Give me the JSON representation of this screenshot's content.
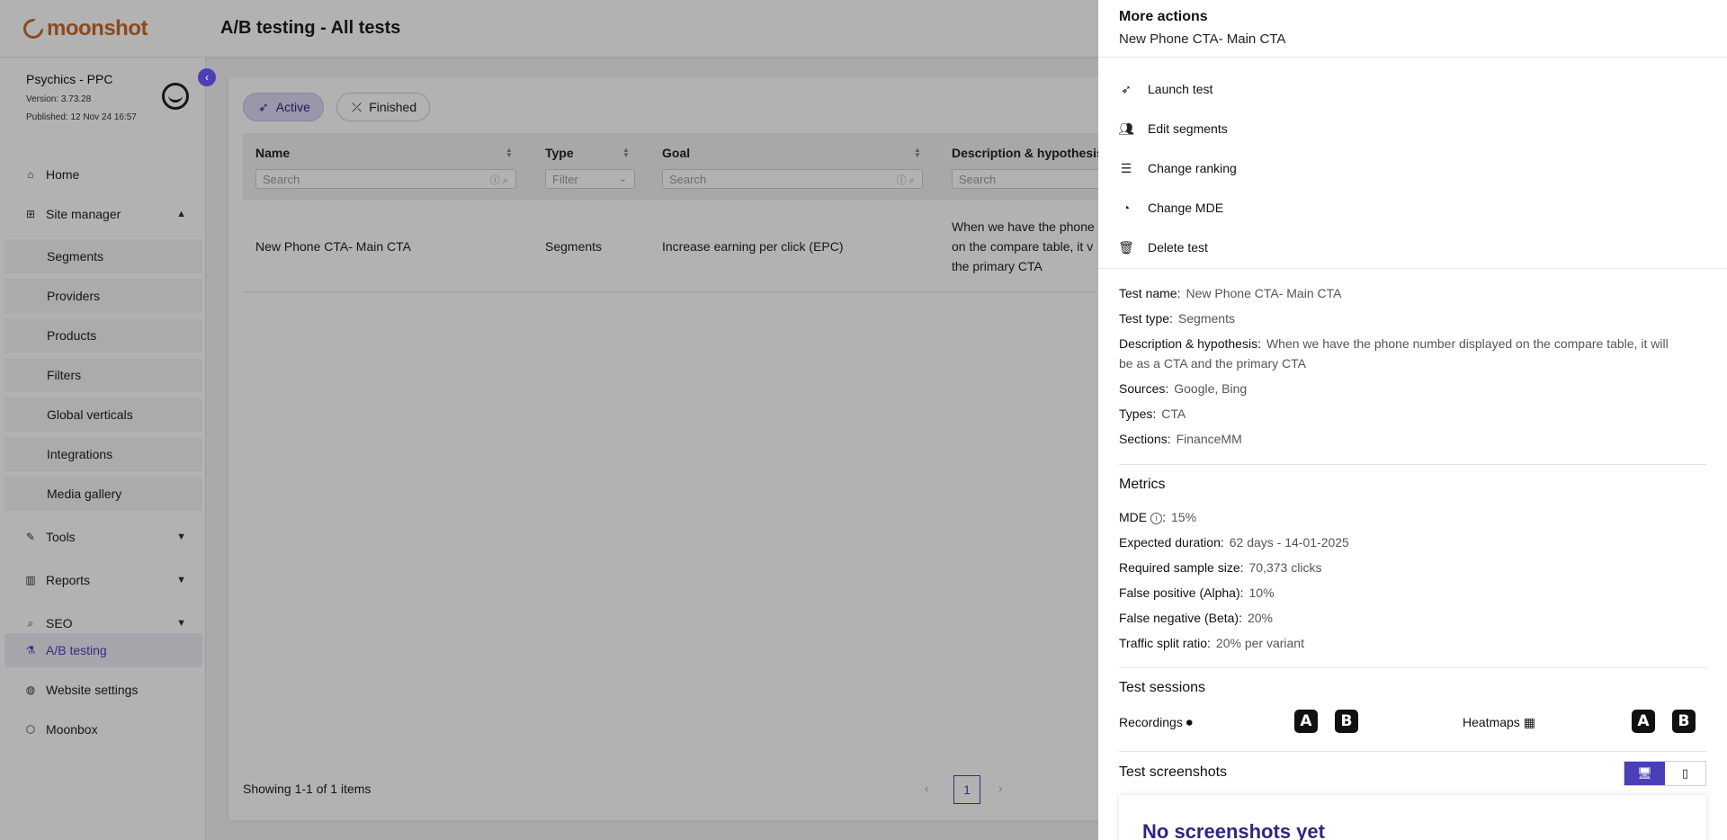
{
  "app": {
    "logo_text": "moonshot",
    "page_title": "A/B testing - All tests"
  },
  "sidebar": {
    "site_name": "Psychics - PPC",
    "version": "Version: 3.73.28",
    "published": "Published: 12 Nov 24 16:57",
    "items": [
      {
        "label": "Home",
        "icon": "home-icon"
      },
      {
        "label": "Site manager",
        "icon": "sitemap-icon"
      },
      {
        "label": "Segments"
      },
      {
        "label": "Providers"
      },
      {
        "label": "Products"
      },
      {
        "label": "Filters"
      },
      {
        "label": "Global verticals"
      },
      {
        "label": "Integrations"
      },
      {
        "label": "Media gallery"
      },
      {
        "label": "Tools",
        "icon": "wrench-icon"
      },
      {
        "label": "Reports",
        "icon": "chart-icon"
      },
      {
        "label": "SEO",
        "icon": "seo-icon"
      },
      {
        "label": "A/B testing",
        "icon": "flask-icon"
      },
      {
        "label": "Website settings",
        "icon": "globe-icon"
      },
      {
        "label": "Moonbox",
        "icon": "box-icon"
      }
    ]
  },
  "tabs": {
    "active": "Active",
    "finished": "Finished"
  },
  "grid": {
    "columns": [
      "Name",
      "Type",
      "Goal",
      "Description & hypothesis"
    ],
    "filters": {
      "name": "Search",
      "type": "Filter",
      "goal": "Search",
      "description": "Search"
    },
    "row": {
      "name": "New Phone CTA- Main CTA",
      "type": "Segments",
      "goal": "Increase earning per click (EPC)",
      "desc1": "When we have the phone",
      "desc2": "on the compare table, it v",
      "desc3": "the primary CTA"
    },
    "pager_text": "Showing 1-1 of 1 items",
    "page": "1"
  },
  "drawer": {
    "title": "More actions",
    "subtitle": "New Phone CTA- Main CTA",
    "actions": [
      "Launch test",
      "Edit segments",
      "Change ranking",
      "Change MDE",
      "Delete test"
    ],
    "details": {
      "test_name_label": "Test name:",
      "test_name": "New Phone CTA- Main CTA",
      "test_type_label": "Test type:",
      "test_type": "Segments",
      "desc_label": "Description & hypothesis:",
      "desc_line1": "When we have the phone number displayed on the compare table, it will",
      "desc_line2": "be as a CTA and the primary CTA",
      "sources_label": "Sources:",
      "sources": "Google, Bing",
      "types_label": "Types:",
      "types": "CTA",
      "sections_label": "Sections:",
      "sections": "FinanceMM"
    },
    "metrics": {
      "title": "Metrics",
      "mde_label": "MDE",
      "mde": "15%",
      "duration_label": "Expected duration:",
      "duration": "62 days - 14-01-2025",
      "sample_label": "Required sample size:",
      "sample": "70,373 clicks",
      "alpha_label": "False positive (Alpha):",
      "alpha": "10%",
      "beta_label": "False negative (Beta):",
      "beta": "20%",
      "split_label": "Traffic split ratio:",
      "split": "20% per variant"
    },
    "sessions": {
      "title": "Test sessions",
      "recordings": "Recordings",
      "heatmaps": "Heatmaps",
      "a": "A",
      "b": "B"
    },
    "screenshots": {
      "title": "Test screenshots",
      "empty": "No screenshots yet"
    }
  },
  "colors": {
    "accent": "#4a3fb5",
    "brand": "#c76a2a"
  }
}
